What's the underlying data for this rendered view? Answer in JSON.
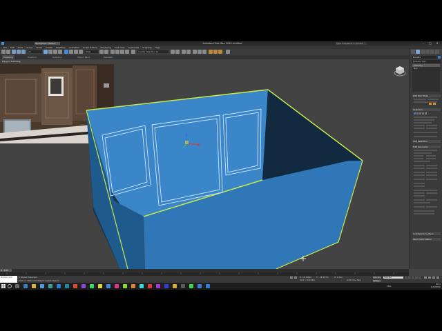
{
  "titlebar": {
    "workspace": "Workspace: Default",
    "title": "Autodesk 3ds Max 2020   Untitled",
    "search_placeholder": "Type a keyword or phrase",
    "minimize": "–",
    "maximize": "□",
    "close": "✕"
  },
  "menu": [
    "File",
    "Edit",
    "Tools",
    "Group",
    "Views",
    "Create",
    "Modifiers",
    "Animation",
    "Graph Editors",
    "Rendering",
    "Civil View",
    "Customize",
    "Scripting",
    "Help"
  ],
  "toolbar": {
    "selection_filter": "All",
    "reference_coord": "View",
    "named_selection": "Create Selection Se"
  },
  "ribbon": {
    "tabs": [
      "Modeling",
      "Freeform",
      "Selection",
      "Object Paint",
      "Populate"
    ],
    "active_index": 0,
    "subtitle": "Polygon Modeling"
  },
  "viewport": {
    "label": "[+] [Perspective] [User Defined] [Default Shading]"
  },
  "command_panel": {
    "object_name": "Box001",
    "object_color": "#3a7ec4",
    "modifier_list": "Modifier List",
    "stack": [
      "Edit Poly",
      "Box"
    ],
    "rollouts": [
      "Edit Poly Mode",
      "Selection",
      "Soft Selection",
      "Edit Geometry",
      "Subdivision Surface",
      "Paint Deformation"
    ],
    "labels": [
      "Model",
      "Animate",
      "<No Current Operation>",
      "Commit",
      "Settings",
      "Cancel",
      "Show Cage",
      "By Vertex",
      "Ignore Backfacing",
      "By Angle",
      "Shrink",
      "Grow",
      "Ring",
      "Loop",
      "Get Stack Selection",
      "Preview Selection",
      "Off",
      "SubObj",
      "Multi",
      "Select Whole Element",
      "Repeat Last",
      "Constraints",
      "None",
      "Edge",
      "Face",
      "Normal",
      "Preserve UVs",
      "Create",
      "Collapse",
      "Attach",
      "Detach",
      "Slice Plane",
      "Split",
      "Slice",
      "Reset Plane",
      "QuickSlice",
      "Cut",
      "MSmooth",
      "Tessellate",
      "Make Planar",
      "X",
      "Y",
      "Z",
      "View Align",
      "Grid Align",
      "Relax",
      "Hide Selected",
      "Unhide All",
      "Hide Unselected",
      "Named Selections:",
      "Copy",
      "Paste",
      "Delete Isolated Vertices",
      "Full Interactivity"
    ]
  },
  "timeline": {
    "slider": "0 / 100",
    "ticks": [
      "0",
      "5",
      "10",
      "15",
      "20",
      "25",
      "30",
      "35",
      "40",
      "45",
      "50",
      "55",
      "60",
      "65",
      "70",
      "75",
      "80",
      "85",
      "90",
      "95",
      "100"
    ]
  },
  "status": {
    "maxscript": "MAXScript Mi",
    "line1": "1 Object Selected",
    "line2": "Click or click-and-drag to select objects",
    "x": "X: 18.909m",
    "y": "Y: -13.437m",
    "z": "Z: 0.0m",
    "grid": "Grid = 0.254m",
    "add_time_tag": "Add Time Tag",
    "auto_key": "Auto Key",
    "selected": "Selected",
    "set_key": "Set Key",
    "key_filters": "Key Filters..."
  },
  "taskbar": {
    "time": "16:41",
    "date": "11/02/2020",
    "lang": "ENG"
  },
  "colors": {
    "box_face": "#2f77b6",
    "box_highlight": "#c8e84a",
    "box_interior": "#1a3450",
    "accent": "#3a8fd0"
  }
}
